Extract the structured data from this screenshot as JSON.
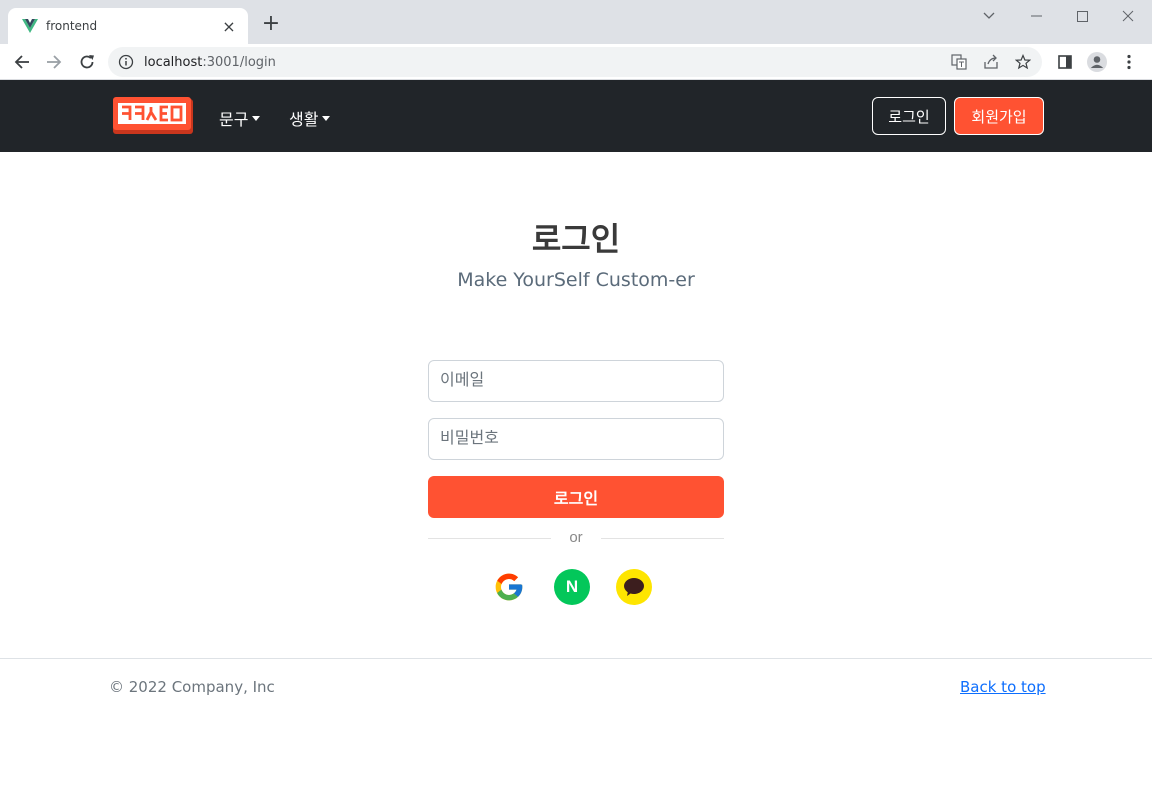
{
  "browser": {
    "tab_title": "frontend",
    "tab_close": "×",
    "new_tab": "+",
    "url_host": "localhost",
    "url_rest": ":3001/login"
  },
  "navbar": {
    "menus": [
      {
        "label": "문구"
      },
      {
        "label": "생활"
      }
    ],
    "login_label": "로그인",
    "signup_label": "회원가입",
    "brand_color": "#ff5232",
    "bg_color": "#212529"
  },
  "main": {
    "title": "로그인",
    "subtitle": "Make YourSelf Custom-er",
    "email_placeholder": "이메일",
    "password_placeholder": "비밀번호",
    "login_button": "로그인",
    "divider": "or",
    "social": [
      {
        "icon": "google-icon"
      },
      {
        "icon": "naver-icon",
        "glyph": "N"
      },
      {
        "icon": "kakao-icon"
      }
    ]
  },
  "footer": {
    "copyright": "© 2022 Company, Inc",
    "back_to_top": "Back to top"
  }
}
